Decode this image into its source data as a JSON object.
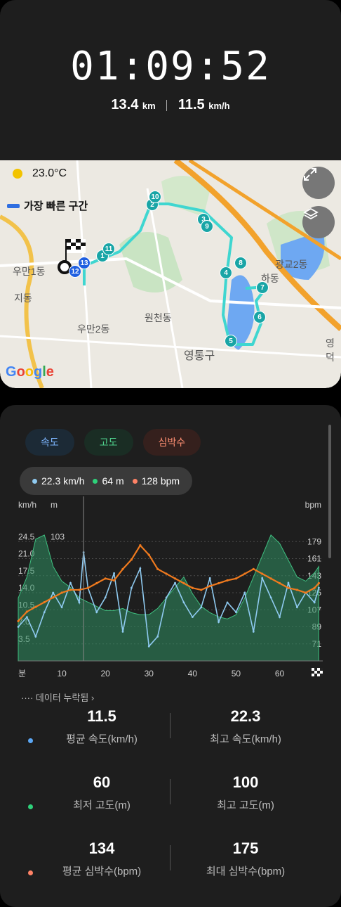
{
  "workout": {
    "duration": "01:09:52",
    "distance": "13.4",
    "distance_unit": "km",
    "avg_speed": "11.5",
    "avg_speed_unit": "km/h"
  },
  "map": {
    "temperature": "23.0°C",
    "fastest_section_label": "가장 빠른 구간",
    "labels": [
      "우만1동",
      "지동",
      "우만2동",
      "원천동",
      "영통구",
      "광교2동",
      "하동",
      "영덕"
    ],
    "waypoints": [
      "1",
      "2",
      "3",
      "4",
      "5",
      "6",
      "7",
      "8",
      "9",
      "10",
      "11",
      "12",
      "13"
    ],
    "google_logo": "Google",
    "expand_icon": "expand-icon",
    "layers_icon": "layers-icon",
    "route_color": "#3fd6d0"
  },
  "tabs": [
    {
      "label": "속도"
    },
    {
      "label": "고도"
    },
    {
      "label": "심박수"
    }
  ],
  "tooltip": {
    "speed": "22.3 km/h",
    "altitude": "64 m",
    "heart_rate": "128 bpm"
  },
  "chart_data": {
    "type": "area",
    "left_units": [
      "km/h",
      "m"
    ],
    "right_unit": "bpm",
    "speed_ticks": [
      "24.5",
      "21.0",
      "17.5",
      "14.0",
      "10.5",
      "7.0",
      "3.5"
    ],
    "altitude_ticks": [
      "103"
    ],
    "hr_ticks": [
      "179",
      "161",
      "143",
      "125",
      "107",
      "89",
      "71"
    ],
    "x_label": "분",
    "x_ticks": [
      "10",
      "20",
      "30",
      "40",
      "50",
      "60"
    ],
    "xlim": [
      0,
      69.9
    ],
    "speed_ylim": [
      0,
      28
    ],
    "hr_ylim": [
      53,
      197
    ],
    "series": [
      {
        "name": "속도",
        "color": "#8fcaf0",
        "x": [
          0,
          2,
          4,
          6,
          8,
          10,
          12,
          14,
          15,
          16,
          18,
          20,
          22,
          24,
          26,
          28,
          30,
          32,
          34,
          36,
          38,
          40,
          42,
          44,
          46,
          48,
          50,
          52,
          54,
          56,
          58,
          60,
          62,
          64,
          66,
          68,
          69
        ],
        "values": [
          7,
          9,
          5,
          10,
          14,
          11,
          16,
          12,
          22.3,
          15,
          10,
          13,
          18,
          6,
          15,
          19,
          3,
          5,
          13,
          16,
          12,
          9,
          11,
          17,
          8,
          12,
          10,
          14,
          6,
          17,
          13,
          9,
          16,
          11,
          14,
          12,
          15
        ]
      },
      {
        "name": "고도",
        "color": "#2f8f63",
        "x": [
          0,
          2,
          4,
          6,
          8,
          10,
          12,
          14,
          16,
          18,
          20,
          22,
          24,
          26,
          28,
          30,
          32,
          34,
          36,
          38,
          40,
          42,
          44,
          46,
          48,
          50,
          52,
          54,
          56,
          58,
          60,
          62,
          64,
          66,
          68,
          69
        ],
        "values": [
          70,
          80,
          98,
          100,
          85,
          78,
          75,
          70,
          68,
          66,
          64,
          64,
          65,
          63,
          62,
          62,
          65,
          70,
          75,
          80,
          72,
          66,
          63,
          61,
          60,
          62,
          70,
          80,
          90,
          100,
          96,
          88,
          80,
          78,
          82,
          85
        ]
      },
      {
        "name": "심박수",
        "color": "#f07a1e",
        "x": [
          0,
          2,
          4,
          6,
          8,
          10,
          12,
          14,
          16,
          18,
          20,
          22,
          24,
          26,
          28,
          30,
          32,
          34,
          36,
          38,
          40,
          42,
          44,
          46,
          48,
          50,
          52,
          54,
          56,
          58,
          60,
          62,
          64,
          66,
          68,
          69
        ],
        "values": [
          95,
          105,
          110,
          115,
          120,
          125,
          128,
          128,
          130,
          135,
          140,
          138,
          150,
          160,
          175,
          165,
          150,
          145,
          140,
          135,
          130,
          128,
          132,
          135,
          138,
          140,
          145,
          150,
          145,
          140,
          135,
          130,
          128,
          125,
          130,
          135
        ]
      }
    ]
  },
  "missing_data_label": "···· 데이터 누락됨 ›",
  "stats": [
    {
      "color": "#5ba7f5",
      "left": {
        "value": "11.5",
        "label": "평균 속도(km/h)"
      },
      "right": {
        "value": "22.3",
        "label": "최고 속도(km/h)"
      }
    },
    {
      "color": "#2ed17a",
      "left": {
        "value": "60",
        "label": "최저 고도(m)"
      },
      "right": {
        "value": "100",
        "label": "최고 고도(m)"
      }
    },
    {
      "color": "#ff8266",
      "left": {
        "value": "134",
        "label": "평균 심박수(bpm)"
      },
      "right": {
        "value": "175",
        "label": "최대 심박수(bpm)"
      }
    }
  ]
}
